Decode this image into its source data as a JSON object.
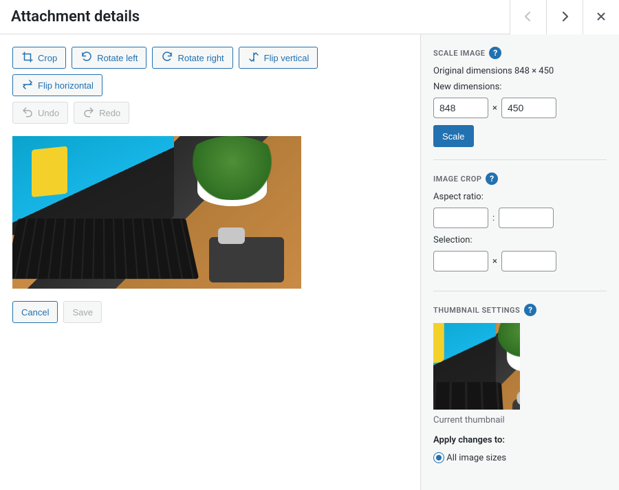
{
  "header": {
    "title": "Attachment details"
  },
  "toolbar": {
    "crop": "Crop",
    "rotate_left": "Rotate left",
    "rotate_right": "Rotate right",
    "flip_vertical": "Flip vertical",
    "flip_horizontal": "Flip horizontal",
    "undo": "Undo",
    "redo": "Redo"
  },
  "actions": {
    "cancel": "Cancel",
    "save": "Save"
  },
  "scale": {
    "heading": "SCALE IMAGE",
    "original_label": "Original dimensions 848 × 450",
    "new_label": "New dimensions:",
    "width": "848",
    "height": "450",
    "button": "Scale"
  },
  "crop": {
    "heading": "IMAGE CROP",
    "aspect_label": "Aspect ratio:",
    "aspect_w": "",
    "aspect_h": "",
    "selection_label": "Selection:",
    "sel_w": "",
    "sel_h": ""
  },
  "thumb": {
    "heading": "THUMBNAIL SETTINGS",
    "caption": "Current thumbnail",
    "apply_label": "Apply changes to:",
    "opt_all": "All image sizes"
  }
}
